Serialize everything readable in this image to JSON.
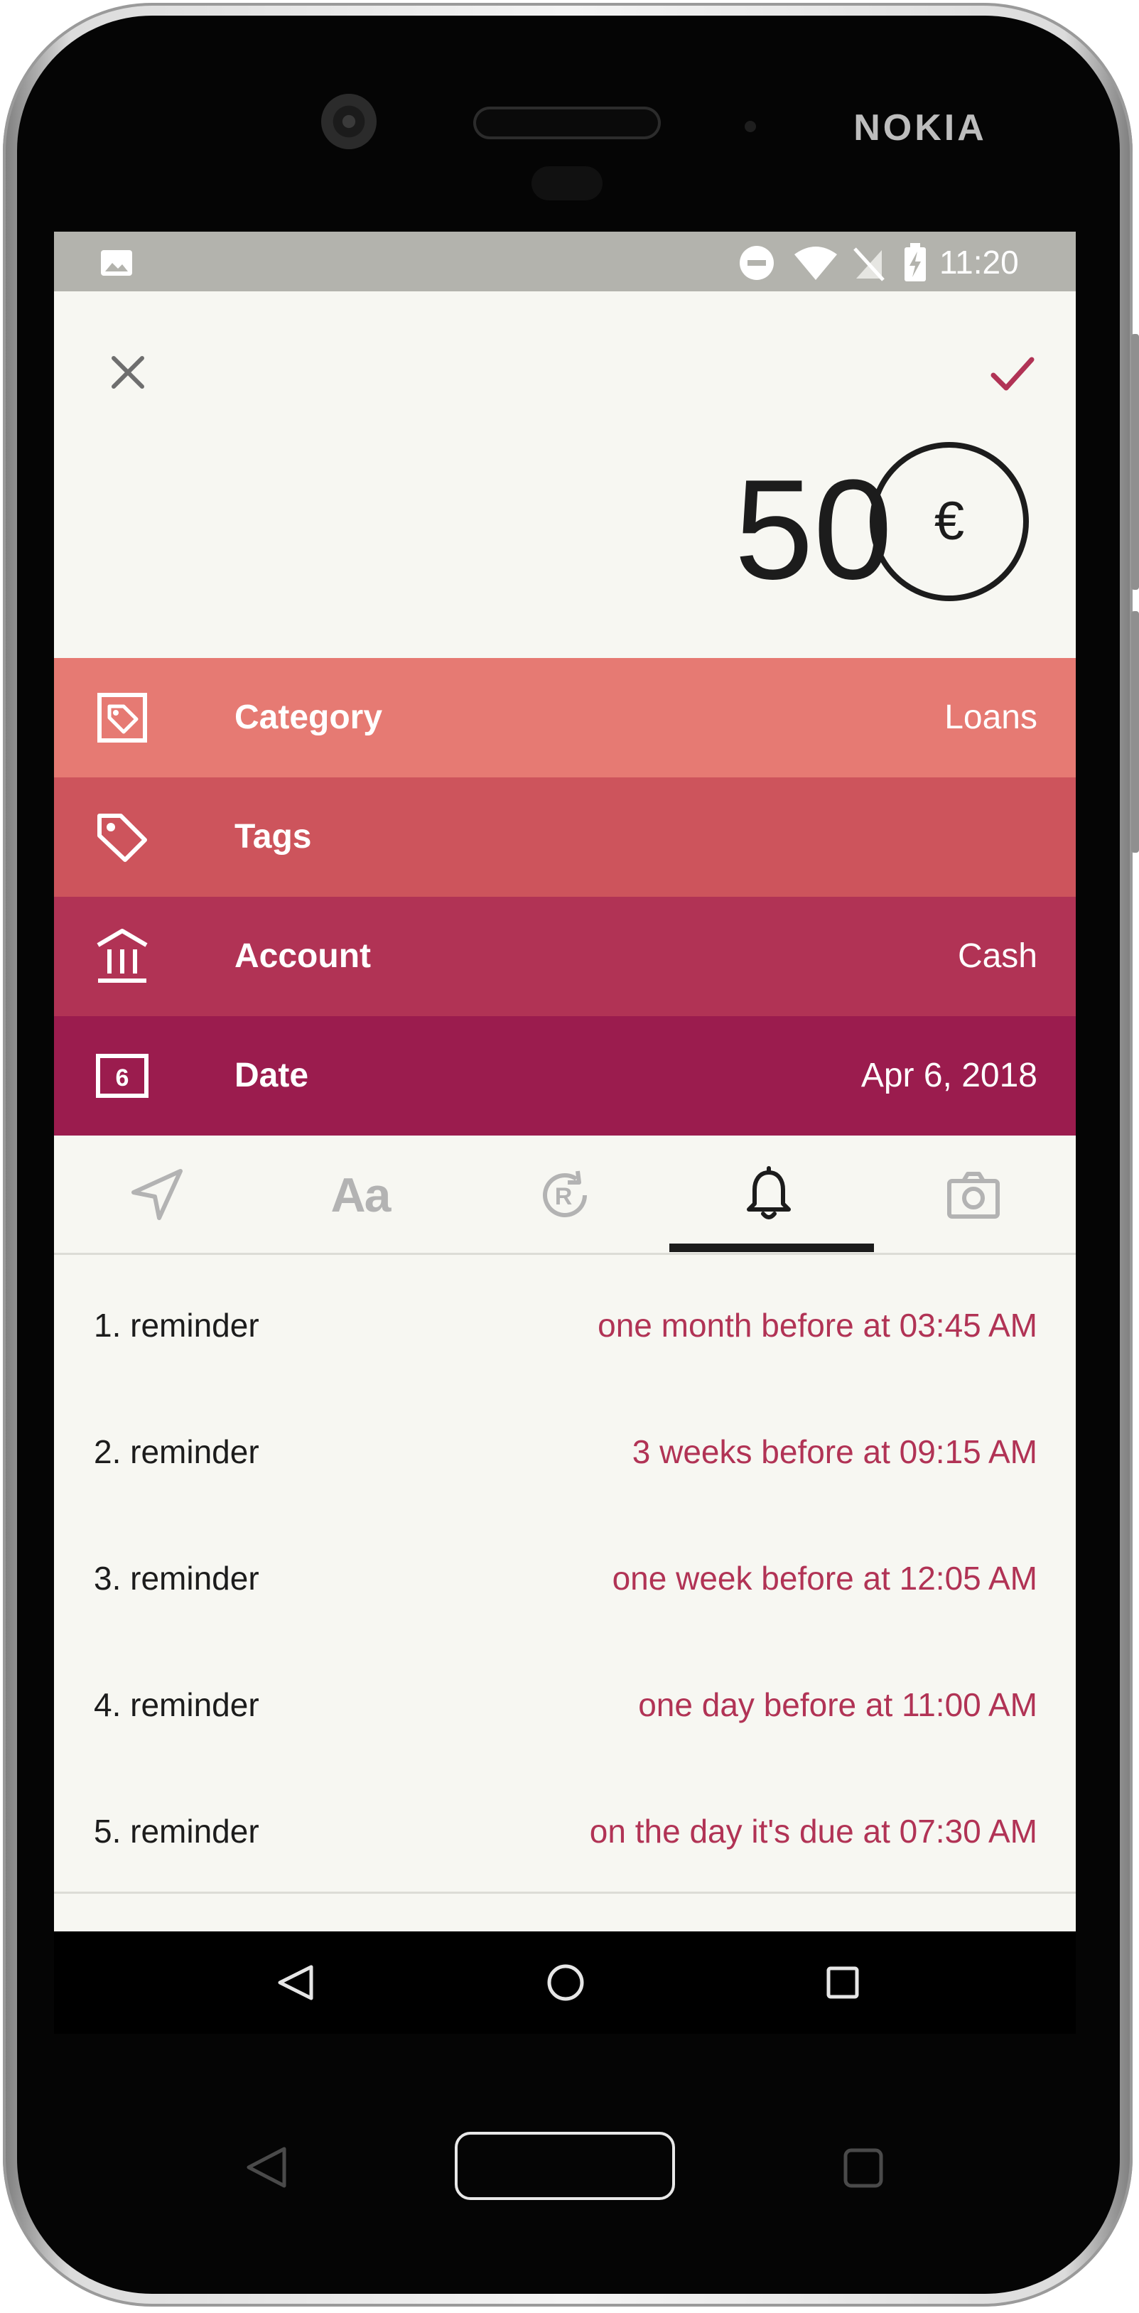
{
  "device": {
    "brand": "NOKIA"
  },
  "status_bar": {
    "time": "11:20",
    "icons": [
      "gallery-icon",
      "do-not-disturb-icon",
      "wifi-icon",
      "no-signal-icon",
      "battery-charging-icon"
    ]
  },
  "toolbar": {
    "close_icon": "close-icon",
    "save_icon": "check-icon"
  },
  "amount": {
    "value": "50",
    "currency_symbol": "€"
  },
  "fields": {
    "category": {
      "label": "Category",
      "value": "Loans",
      "icon": "category-tag-icon",
      "color": "#e67a73"
    },
    "tags": {
      "label": "Tags",
      "value": "",
      "icon": "tag-icon",
      "color": "#cd545c"
    },
    "account": {
      "label": "Account",
      "value": "Cash",
      "icon": "bank-icon",
      "color": "#b13355"
    },
    "date": {
      "label": "Date",
      "value": "Apr 6, 2018",
      "icon": "calendar-icon",
      "day_number": "6",
      "color": "#9b1c4e"
    }
  },
  "tabs": {
    "items": [
      {
        "name": "location",
        "icon": "location-arrow-icon"
      },
      {
        "name": "note",
        "icon": "text-icon",
        "glyph": "Aa"
      },
      {
        "name": "recurring",
        "icon": "recurring-icon"
      },
      {
        "name": "reminders",
        "icon": "bell-icon",
        "active": true
      },
      {
        "name": "attachment",
        "icon": "camera-icon"
      }
    ]
  },
  "reminders": [
    {
      "label": "1. reminder",
      "value": "one month before at 03:45 AM"
    },
    {
      "label": "2. reminder",
      "value": "3 weeks before at 09:15 AM"
    },
    {
      "label": "3. reminder",
      "value": "one week before at 12:05 AM"
    },
    {
      "label": "4. reminder",
      "value": "one day before at 11:00 AM"
    },
    {
      "label": "5. reminder",
      "value": "on the day it's due at 07:30 AM"
    }
  ],
  "colors": {
    "accent": "#b13355",
    "background": "#f7f7f2",
    "status_bar": "#b3b3ad"
  }
}
